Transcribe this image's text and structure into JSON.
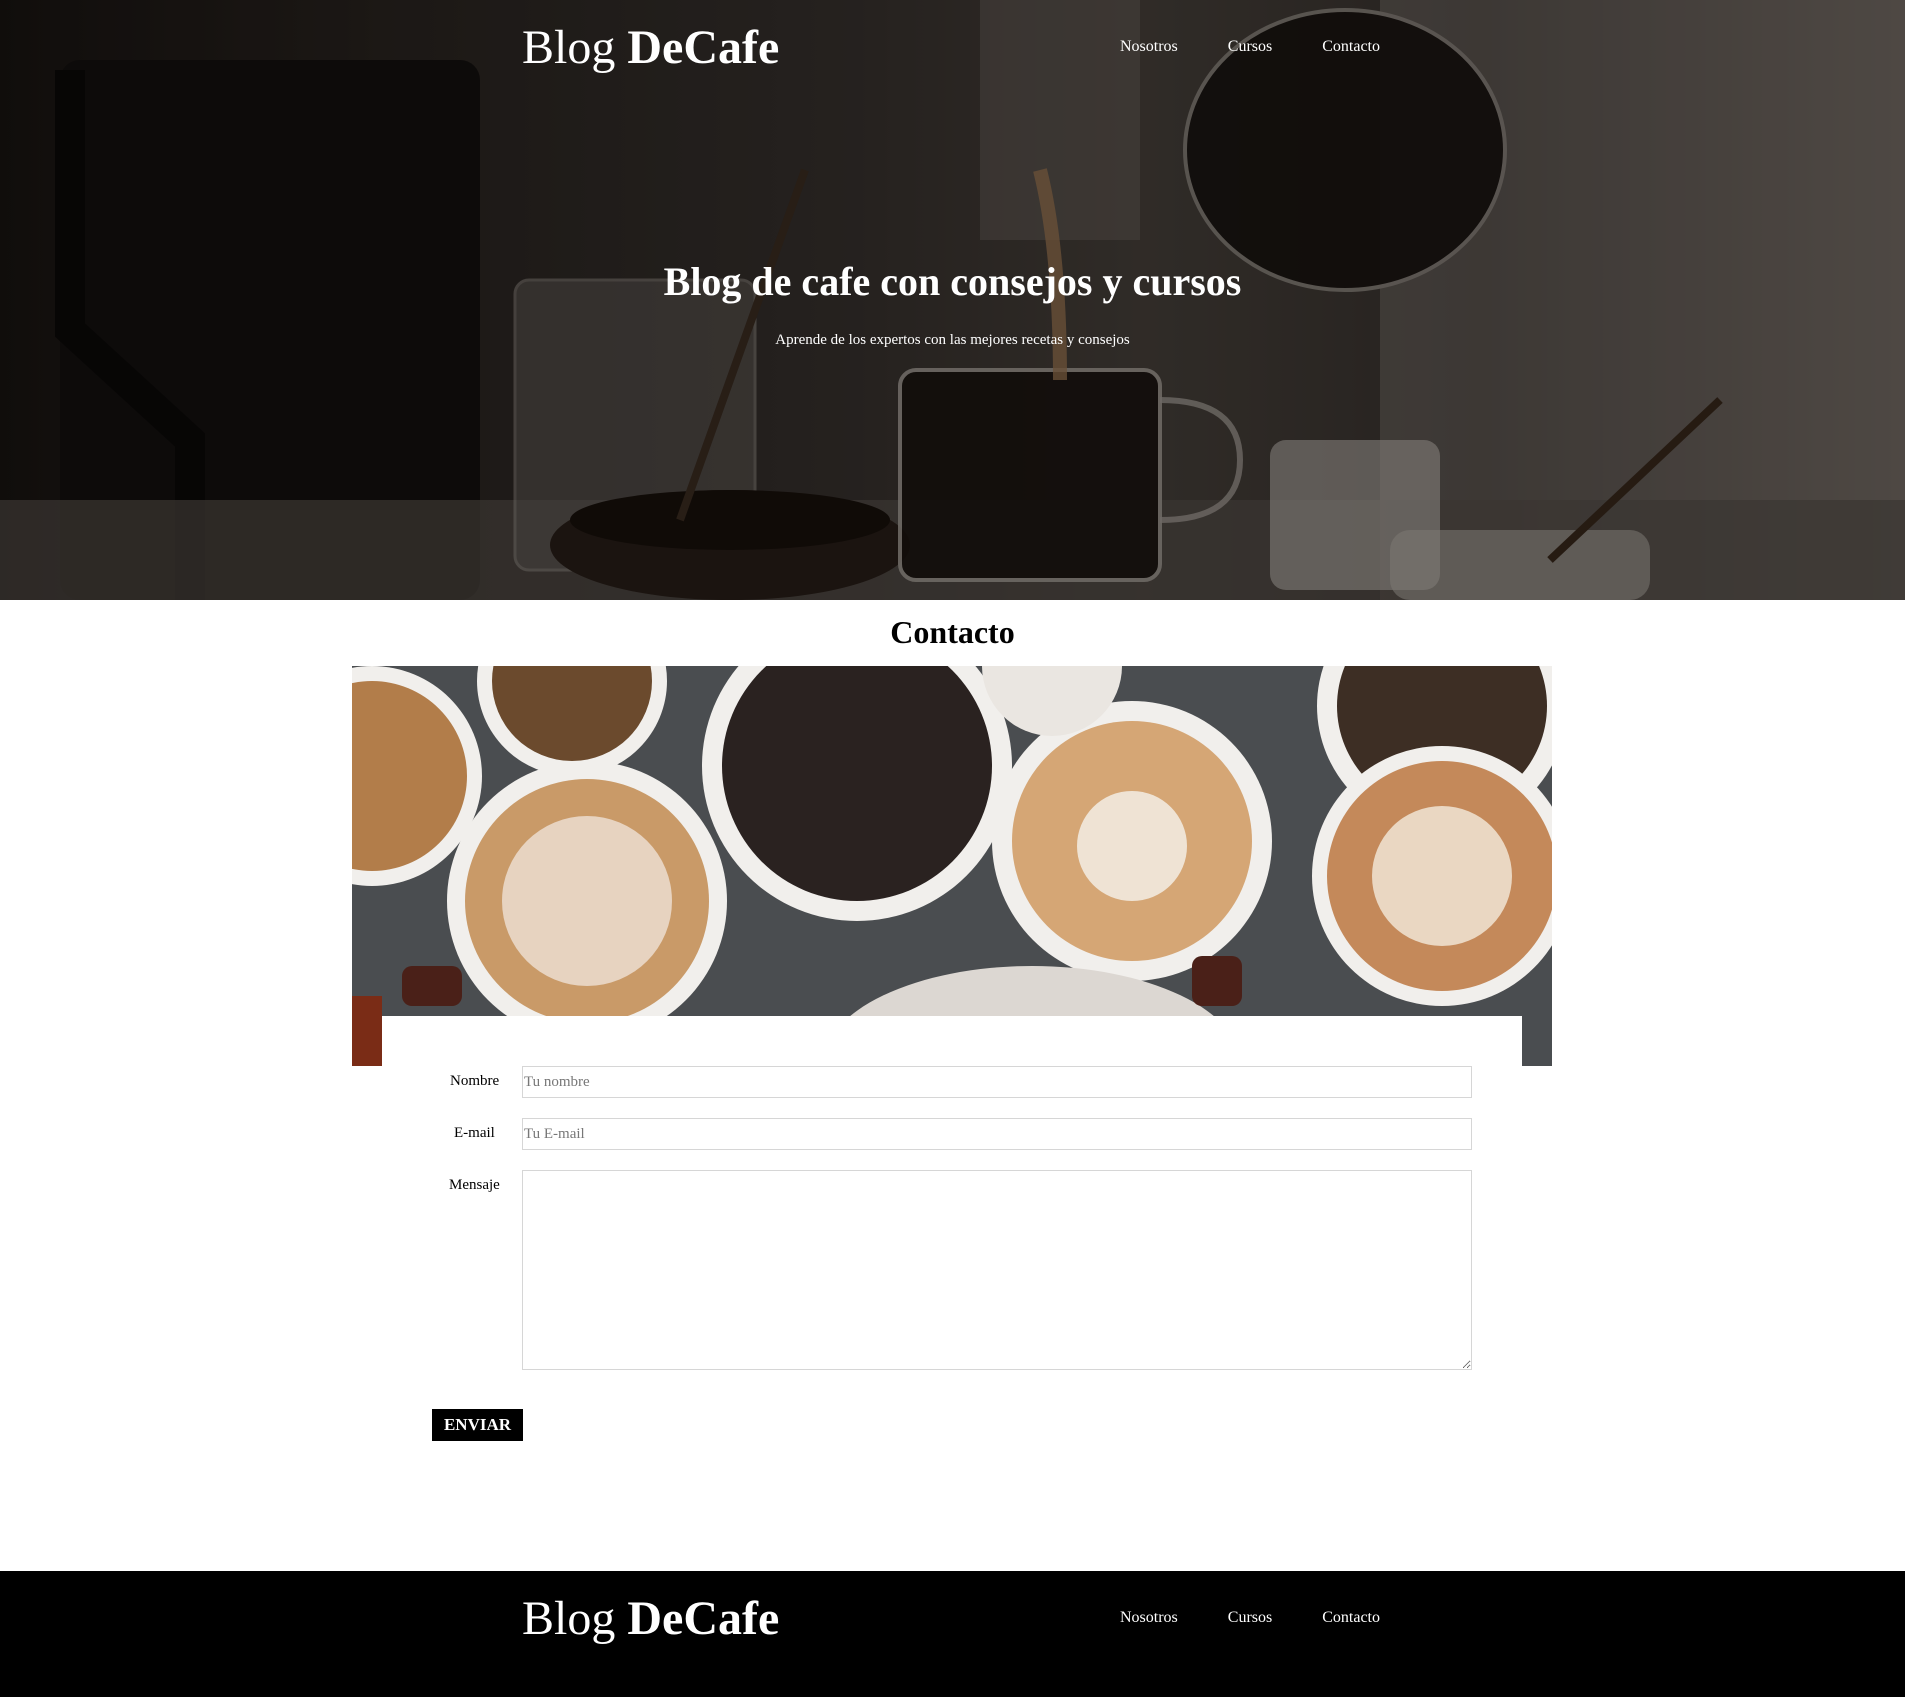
{
  "header": {
    "brand_light": "Blog ",
    "brand_bold": "DeCafe",
    "nav": [
      {
        "label": "Nosotros"
      },
      {
        "label": "Cursos"
      },
      {
        "label": "Contacto"
      }
    ]
  },
  "hero": {
    "title": "Blog de cafe con consejos y cursos",
    "subtitle": "Aprende de los expertos con las mejores recetas y consejos"
  },
  "contact": {
    "title": "Contacto",
    "form": {
      "name_label": "Nombre",
      "name_placeholder": "Tu nombre",
      "email_label": "E-mail",
      "email_placeholder": "Tu E-mail",
      "message_label": "Mensaje",
      "submit_label": "ENVIAR"
    }
  },
  "footer": {
    "brand_light": "Blog ",
    "brand_bold": "DeCafe",
    "nav": [
      {
        "label": "Nosotros"
      },
      {
        "label": "Cursos"
      },
      {
        "label": "Contacto"
      }
    ]
  }
}
